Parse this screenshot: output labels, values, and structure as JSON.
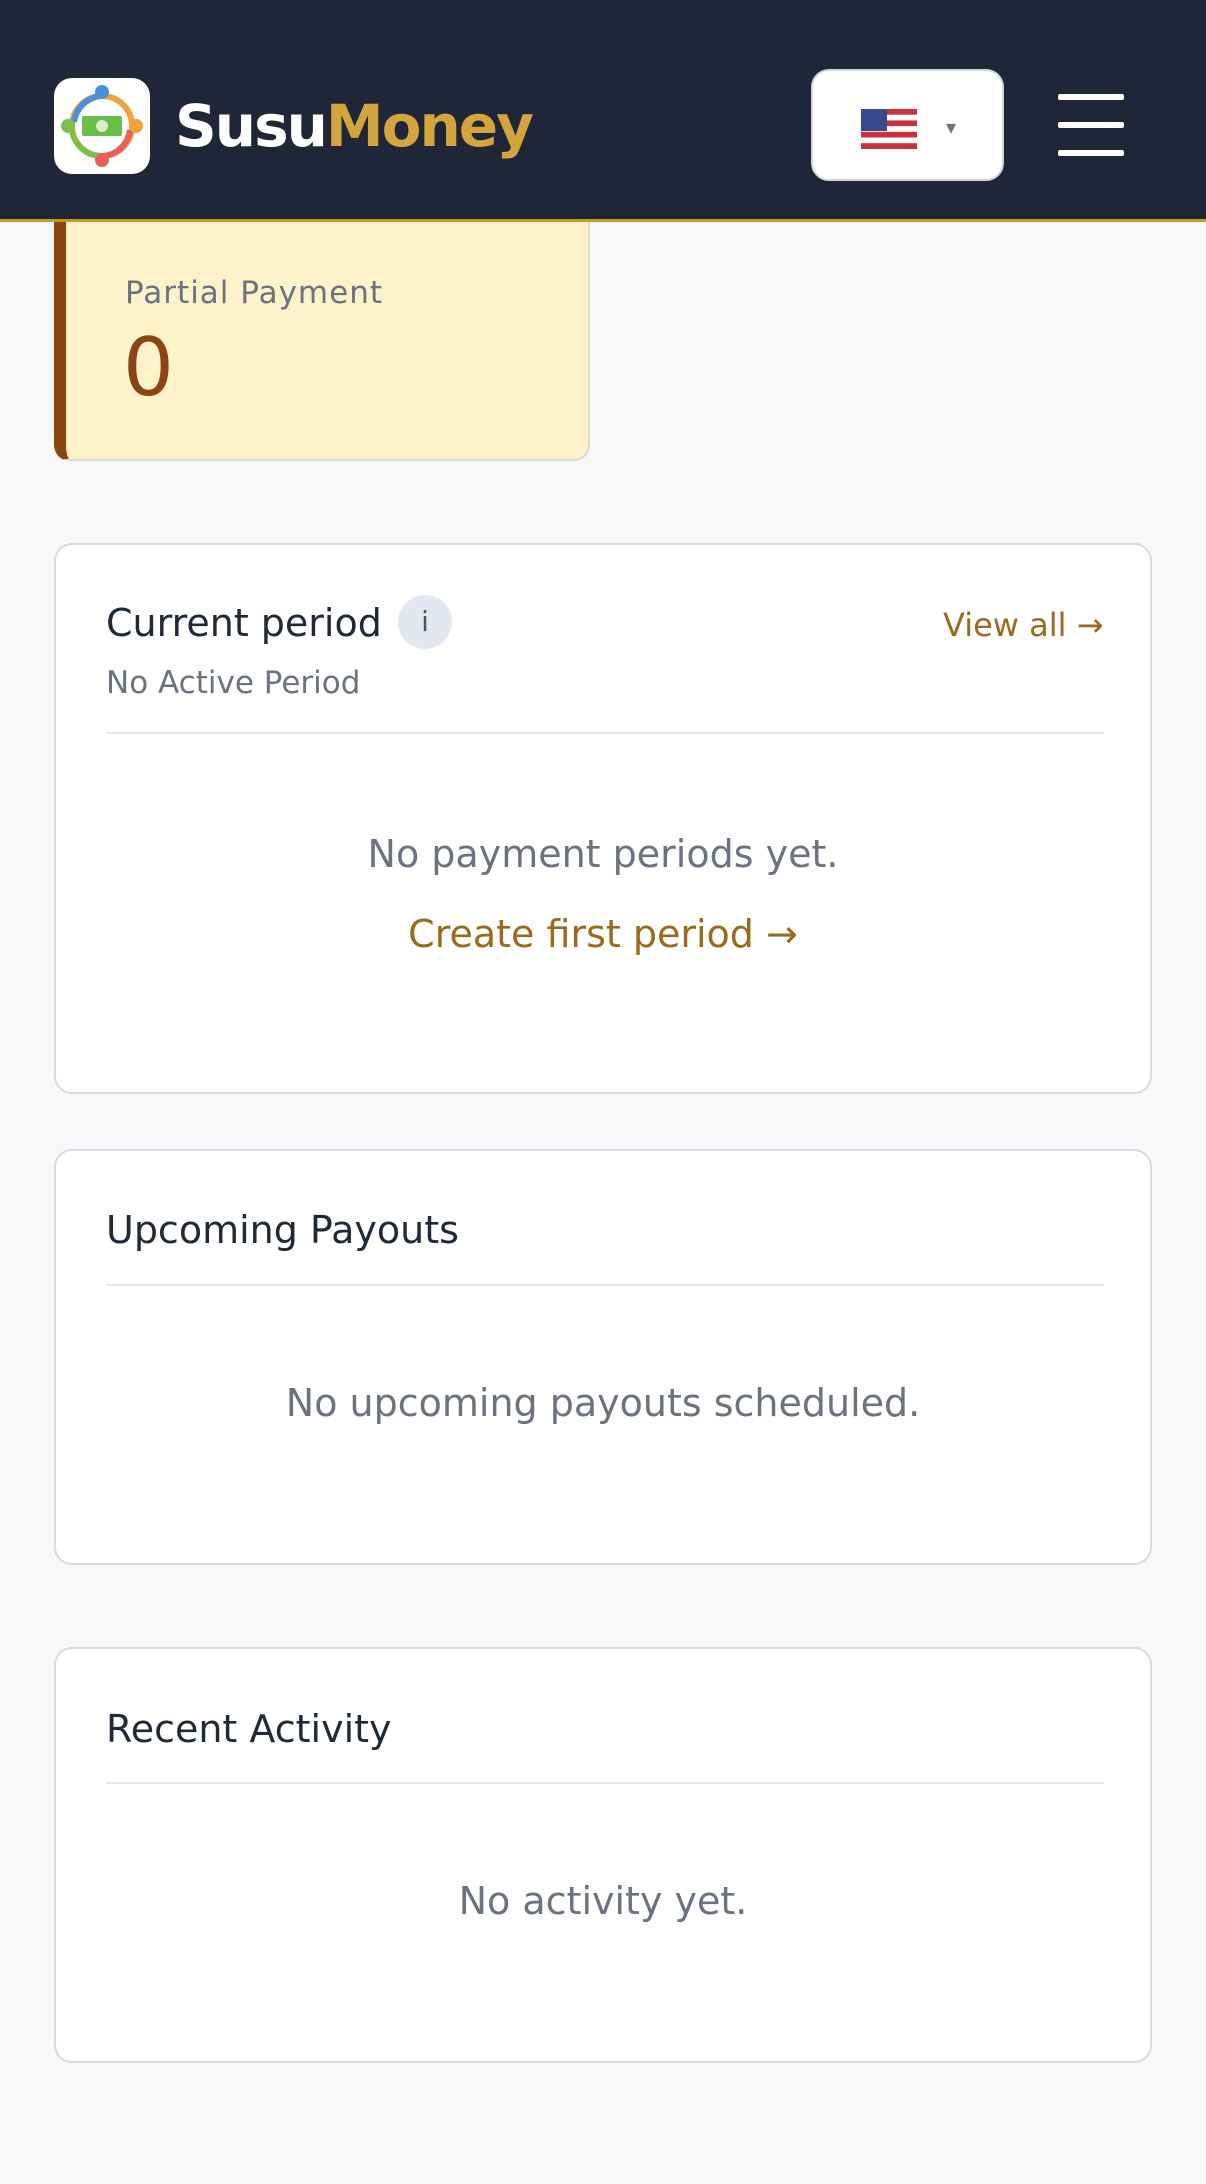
{
  "header": {
    "brand_part1": "Susu",
    "brand_part2": "Money",
    "logo_icon": "susumoney-logo-icon",
    "language_flag": "us-flag-icon",
    "language_caret": "▾",
    "menu_icon": "hamburger-menu-icon"
  },
  "stat": {
    "label": "Partial Payment",
    "value": "0"
  },
  "current_period": {
    "title": "Current period",
    "info_label": "i",
    "subtitle": "No Active Period",
    "view_all": "View all →",
    "empty_text": "No payment periods yet.",
    "create_link": "Create first period →"
  },
  "upcoming_payouts": {
    "title": "Upcoming Payouts",
    "empty_text": "No upcoming payouts scheduled."
  },
  "recent_activity": {
    "title": "Recent Activity",
    "empty_text": "No activity yet."
  },
  "colors": {
    "header_bg": "#1f2638",
    "brand_accent": "#d4a53c",
    "link": "#9a6b1c",
    "stat_bg": "#fdf2c9",
    "stat_accent": "#8b4513"
  }
}
